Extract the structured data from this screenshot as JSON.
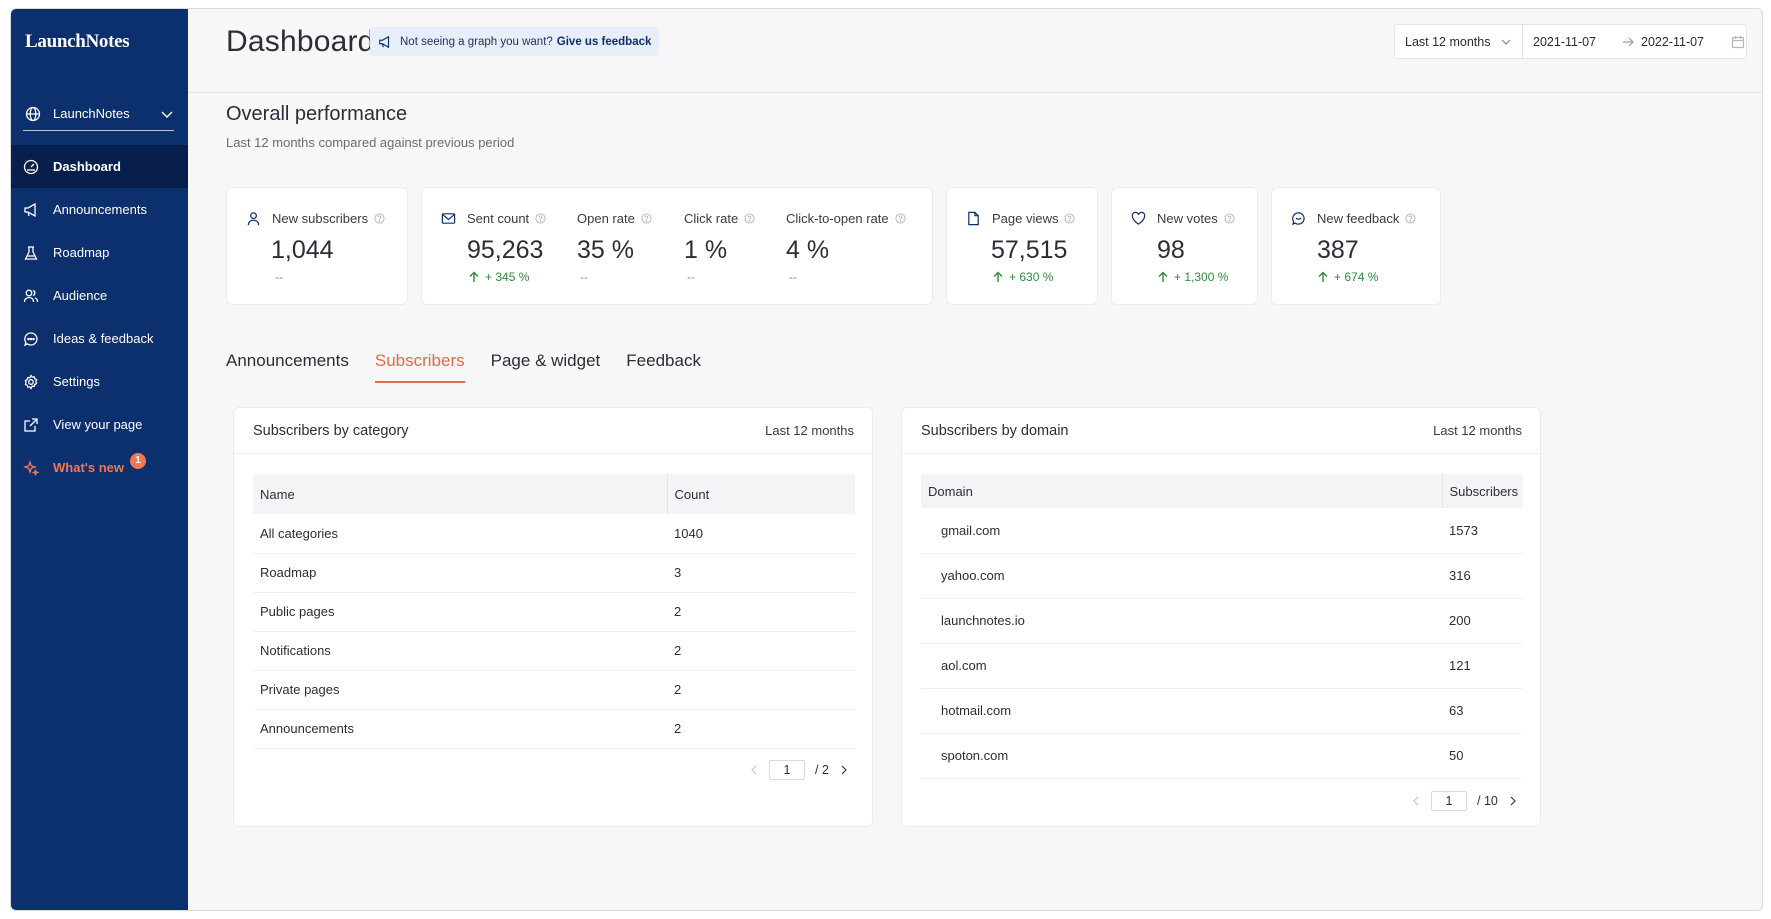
{
  "app": {
    "logo": "LaunchNotes",
    "workspace": "LaunchNotes"
  },
  "sidebar": {
    "items": [
      {
        "label": "Dashboard",
        "icon": "dashboard-icon",
        "active": true
      },
      {
        "label": "Announcements",
        "icon": "megaphone-icon"
      },
      {
        "label": "Roadmap",
        "icon": "flask-icon"
      },
      {
        "label": "Audience",
        "icon": "users-icon"
      },
      {
        "label": "Ideas & feedback",
        "icon": "chat-bubble-icon"
      },
      {
        "label": "Settings",
        "icon": "gear-icon"
      },
      {
        "label": "View your page",
        "icon": "external-link-icon"
      },
      {
        "label": "What's new",
        "icon": "sparkle-icon",
        "badge": "1"
      }
    ]
  },
  "header": {
    "title": "Dashboard",
    "feedback_prompt": "Not seeing a graph you want?",
    "feedback_link": "Give us feedback",
    "range_select": "Last 12 months",
    "date_from": "2021-11-07",
    "date_to": "2022-11-07"
  },
  "overview": {
    "title": "Overall performance",
    "subtitle": "Last 12 months compared against previous period"
  },
  "metrics": {
    "new_subscribers": {
      "label": "New subscribers",
      "value": "1,044",
      "delta": "--"
    },
    "sent_count": {
      "label": "Sent count",
      "value": "95,263",
      "delta": "+ 345 %"
    },
    "open_rate": {
      "label": "Open rate",
      "value": "35 %",
      "delta": "--"
    },
    "click_rate": {
      "label": "Click rate",
      "value": "1 %",
      "delta": "--"
    },
    "click_to_open": {
      "label": "Click-to-open rate",
      "value": "4 %",
      "delta": "--"
    },
    "page_views": {
      "label": "Page views",
      "value": "57,515",
      "delta": "+ 630 %"
    },
    "new_votes": {
      "label": "New votes",
      "value": "98",
      "delta": "+ 1,300 %"
    },
    "new_feedback": {
      "label": "New feedback",
      "value": "387",
      "delta": "+ 674 %"
    }
  },
  "tabs": [
    {
      "label": "Announcements"
    },
    {
      "label": "Subscribers",
      "active": true
    },
    {
      "label": "Page & widget"
    },
    {
      "label": "Feedback"
    }
  ],
  "category_panel": {
    "title": "Subscribers by category",
    "period": "Last 12 months",
    "columns": [
      "Name",
      "Count"
    ],
    "rows": [
      [
        "All categories",
        "1040"
      ],
      [
        "Roadmap",
        "3"
      ],
      [
        "Public pages",
        "2"
      ],
      [
        "Notifications",
        "2"
      ],
      [
        "Private pages",
        "2"
      ],
      [
        "Announcements",
        "2"
      ]
    ],
    "page": "1",
    "pages": "/ 2"
  },
  "domain_panel": {
    "title": "Subscribers by domain",
    "period": "Last 12 months",
    "columns": [
      "Domain",
      "Subscribers"
    ],
    "rows": [
      [
        "gmail.com",
        "1573"
      ],
      [
        "yahoo.com",
        "316"
      ],
      [
        "launchnotes.io",
        "200"
      ],
      [
        "aol.com",
        "121"
      ],
      [
        "hotmail.com",
        "63"
      ],
      [
        "spoton.com",
        "50"
      ]
    ],
    "page": "1",
    "pages": "/ 10"
  },
  "colors": {
    "sidebar": "#0c2f6d",
    "accent": "#e46a44",
    "positive": "#2d8a3a"
  }
}
